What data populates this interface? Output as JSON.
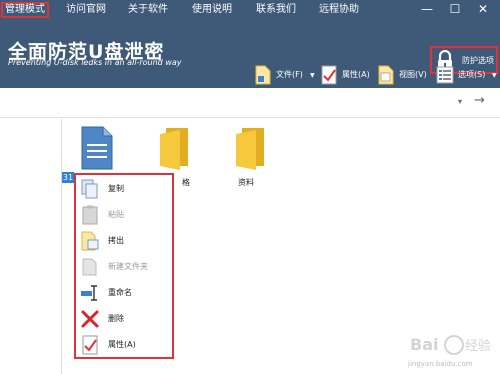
{
  "menubar": {
    "items": [
      "管理模式",
      "访问官网",
      "关于软件",
      "使用说明",
      "联系我们",
      "远程协助"
    ],
    "active_index": 0,
    "window_buttons": [
      "—",
      "☐",
      "✕"
    ]
  },
  "header": {
    "title": "全面防范U盘泄密",
    "subtitle": "Preventing U-disk ledks in an all-round way",
    "lock_label": "防护选项",
    "bg_color": "#3f5a78",
    "toolbar": [
      {
        "label": "文件(F)",
        "icon": "document-icon",
        "dropdown": true
      },
      {
        "label": "属性(A)",
        "icon": "checklist-icon",
        "dropdown": false
      },
      {
        "label": "视图(V)",
        "icon": "view-icon",
        "dropdown": false
      },
      {
        "label": "选项(S)",
        "icon": "options-list-icon",
        "dropdown": true
      }
    ]
  },
  "addrbar": {
    "caret": "▾",
    "arrow": "→"
  },
  "files": [
    {
      "label": "",
      "icon": "blue-document-icon",
      "selected": true
    },
    {
      "label": "格",
      "icon": "folder-icon",
      "selected": false
    },
    {
      "label": "资料",
      "icon": "folder-icon",
      "selected": false
    }
  ],
  "selection_badge": "31",
  "context_menu": [
    {
      "label": "复制",
      "icon": "copy-icon",
      "enabled": true
    },
    {
      "label": "粘贴",
      "icon": "paste-icon",
      "enabled": false
    },
    {
      "label": "拷出",
      "icon": "export-icon",
      "enabled": true
    },
    {
      "label": "新建文件夹",
      "icon": "new-folder-icon",
      "enabled": false
    },
    {
      "label": "重命名",
      "icon": "rename-icon",
      "enabled": true
    },
    {
      "label": "删除",
      "icon": "delete-icon",
      "enabled": true
    },
    {
      "label": "属性(A)",
      "icon": "properties-icon",
      "enabled": true
    }
  ],
  "watermark": {
    "text": "jingyan.baidu.com"
  },
  "colors": {
    "accent_red": "#e0323b",
    "header_blue": "#3f5a78",
    "folder_yellow": "#f6c93c",
    "doc_blue": "#4f86c6"
  }
}
